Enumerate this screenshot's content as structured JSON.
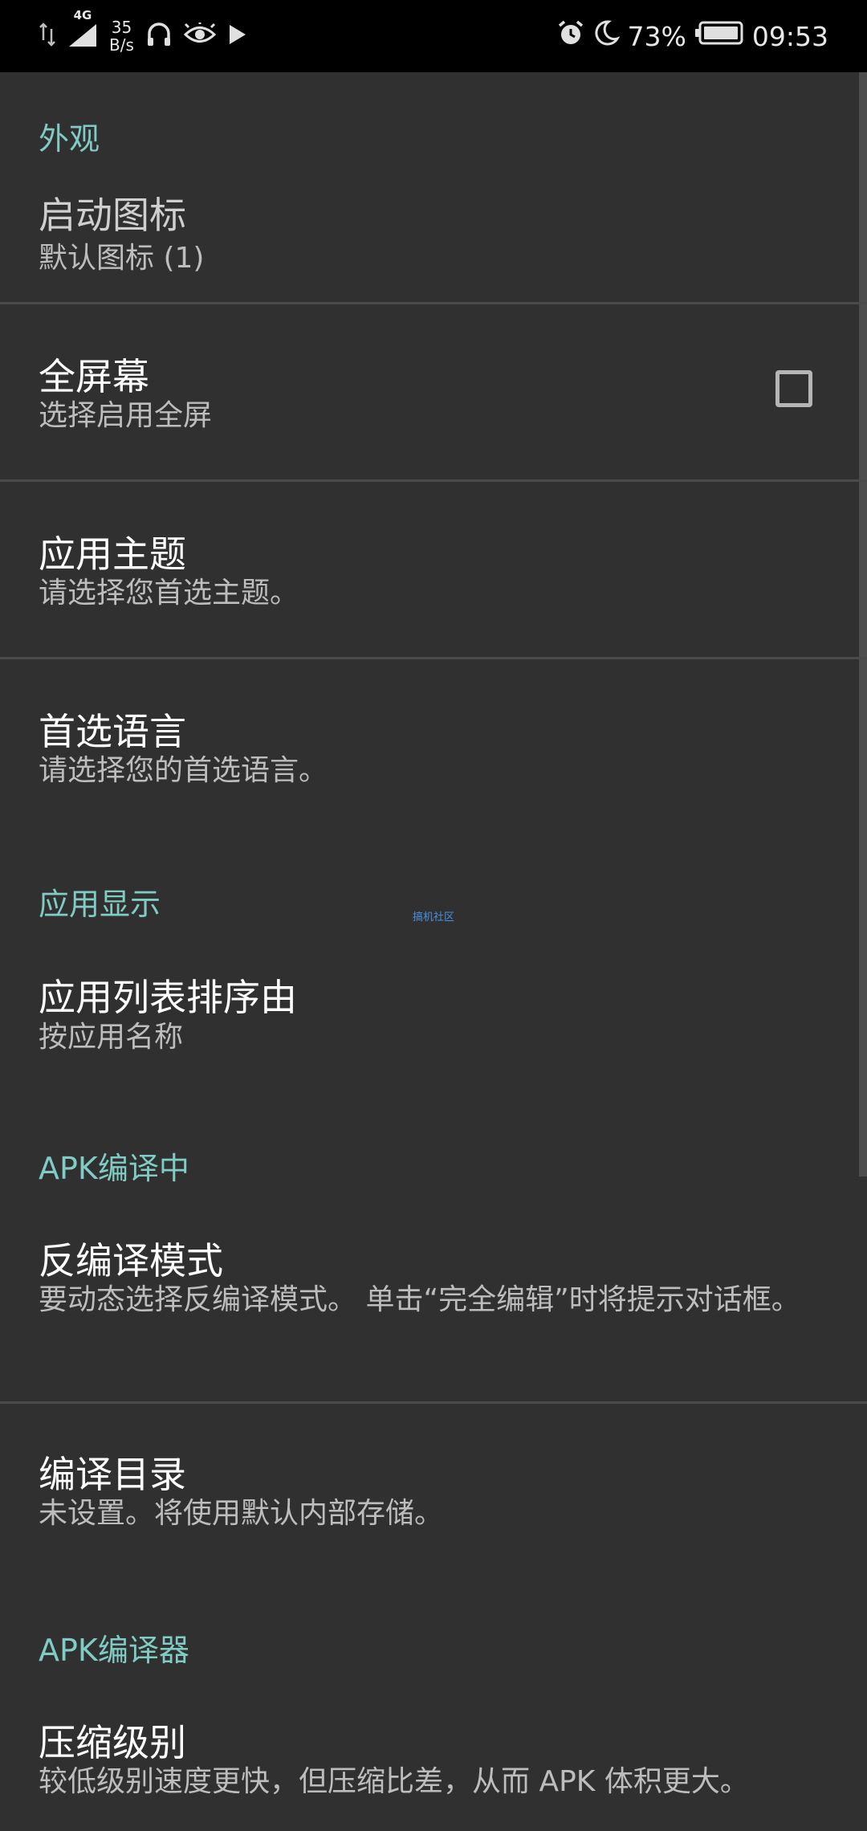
{
  "status_bar": {
    "network_speed_value": "35",
    "network_speed_unit": "B/s",
    "network_type": "4G",
    "battery": "73%",
    "time": "09:53",
    "icons": [
      "data-arrows-icon",
      "signal-icon",
      "headphones-icon",
      "eye-icon",
      "play-icon",
      "alarm-icon",
      "moon-icon",
      "battery-icon"
    ]
  },
  "colors": {
    "background": "#303030",
    "category_accent": "#80cbc4",
    "title": "#ffffff",
    "summary": "#bdbdbd",
    "divider": "#4a4a4a",
    "status_bar": "#000000"
  },
  "sections": {
    "appearance": {
      "header": "外观",
      "launcher_icon": {
        "title": "启动图标",
        "summary": "默认图标 (1)"
      },
      "fullscreen": {
        "title": "全屏幕",
        "summary": "选择启用全屏",
        "checked": false
      },
      "app_theme": {
        "title": "应用主题",
        "summary": "请选择您首选主题。"
      },
      "language": {
        "title": "首选语言",
        "summary": "请选择您的首选语言。"
      }
    },
    "app_display": {
      "header": "应用显示",
      "sort_by": {
        "title": "应用列表排序由",
        "summary": "按应用名称"
      }
    },
    "apk_decompile": {
      "header": "APK编译中",
      "decompile_mode": {
        "title": "反编译模式",
        "summary": "要动态选择反编译模式。 单击“完全编辑”时将提示对话框。"
      },
      "compile_dir": {
        "title": "编译目录",
        "summary": "未设置。将使用默认内部存储。"
      }
    },
    "apk_compiler": {
      "header": "APK编译器",
      "compression": {
        "title": "压缩级别",
        "summary": "较低级别速度更快，但压缩比差，从而 APK 体积更大。"
      }
    }
  },
  "watermark": "搞机社区"
}
